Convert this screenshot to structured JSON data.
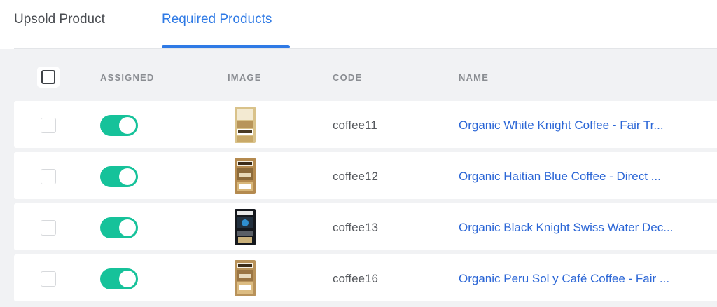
{
  "tabs": {
    "upsold": "Upsold Product",
    "required": "Required Products",
    "active": "required"
  },
  "table": {
    "headers": {
      "assigned": "ASSIGNED",
      "image": "IMAGE",
      "code": "CODE",
      "name": "NAME"
    },
    "rows": [
      {
        "assigned": true,
        "code": "coffee11",
        "name": "Organic White Knight Coffee - Fair Tr...",
        "image_variant": "light"
      },
      {
        "assigned": true,
        "code": "coffee12",
        "name": "Organic Haitian Blue Coffee - Direct ...",
        "image_variant": "kraft"
      },
      {
        "assigned": true,
        "code": "coffee13",
        "name": "Organic Black Knight Swiss Water Dec...",
        "image_variant": "dark"
      },
      {
        "assigned": true,
        "code": "coffee16",
        "name": "Organic Peru Sol y Café Coffee - Fair ...",
        "image_variant": "kraft"
      }
    ]
  },
  "colors": {
    "accent": "#2f7ae5",
    "toggle_on": "#16c29a",
    "link": "#2b66d6"
  }
}
